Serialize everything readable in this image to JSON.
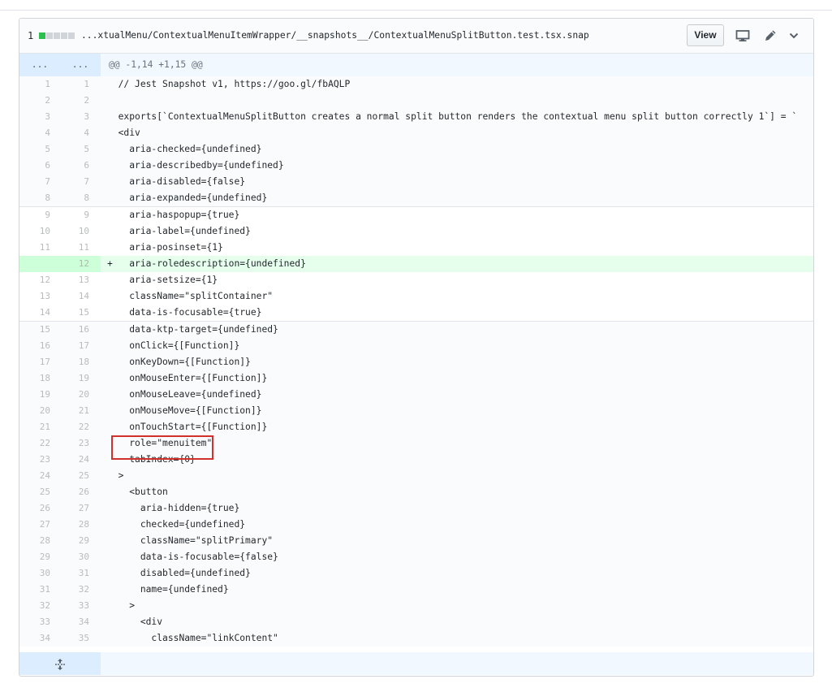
{
  "file": {
    "diffstat_count": "1",
    "path": "...xtualMenu/ContextualMenuItemWrapper/__snapshots__/ContextualMenuSplitButton.test.tsx.snap",
    "view_label": "View",
    "icons": [
      "desktop-icon",
      "pencil-icon",
      "chevron-down-icon"
    ]
  },
  "hunk": {
    "old_marker": "...",
    "new_marker": "...",
    "header": "@@ -1,14 +1,15 @@"
  },
  "lines": [
    {
      "old": "1",
      "new": "1",
      "sign": " ",
      "text": "// Jest Snapshot v1, https://goo.gl/fbAQLP"
    },
    {
      "old": "2",
      "new": "2",
      "sign": " ",
      "text": ""
    },
    {
      "old": "3",
      "new": "3",
      "sign": " ",
      "text": "exports[`ContextualMenuSplitButton creates a normal split button renders the contextual menu split button correctly 1`] = `"
    },
    {
      "old": "4",
      "new": "4",
      "sign": " ",
      "text": "<div"
    },
    {
      "old": "5",
      "new": "5",
      "sign": " ",
      "text": "  aria-checked={undefined}"
    },
    {
      "old": "6",
      "new": "6",
      "sign": " ",
      "text": "  aria-describedby={undefined}"
    },
    {
      "old": "7",
      "new": "7",
      "sign": " ",
      "text": "  aria-disabled={false}"
    },
    {
      "old": "8",
      "new": "8",
      "sign": " ",
      "text": "  aria-expanded={undefined}"
    },
    {
      "old": "9",
      "new": "9",
      "sign": " ",
      "text": "  aria-haspopup={true}"
    },
    {
      "old": "10",
      "new": "10",
      "sign": " ",
      "text": "  aria-label={undefined}"
    },
    {
      "old": "11",
      "new": "11",
      "sign": " ",
      "text": "  aria-posinset={1}"
    },
    {
      "old": "",
      "new": "12",
      "sign": "+",
      "text": "  aria-roledescription={undefined}"
    },
    {
      "old": "12",
      "new": "13",
      "sign": " ",
      "text": "  aria-setsize={1}"
    },
    {
      "old": "13",
      "new": "14",
      "sign": " ",
      "text": "  className=\"splitContainer\""
    },
    {
      "old": "14",
      "new": "15",
      "sign": " ",
      "text": "  data-is-focusable={true}"
    },
    {
      "old": "15",
      "new": "16",
      "sign": " ",
      "text": "  data-ktp-target={undefined}"
    },
    {
      "old": "16",
      "new": "17",
      "sign": " ",
      "text": "  onClick={[Function]}"
    },
    {
      "old": "17",
      "new": "18",
      "sign": " ",
      "text": "  onKeyDown={[Function]}"
    },
    {
      "old": "18",
      "new": "19",
      "sign": " ",
      "text": "  onMouseEnter={[Function]}"
    },
    {
      "old": "19",
      "new": "20",
      "sign": " ",
      "text": "  onMouseLeave={undefined}"
    },
    {
      "old": "20",
      "new": "21",
      "sign": " ",
      "text": "  onMouseMove={[Function]}"
    },
    {
      "old": "21",
      "new": "22",
      "sign": " ",
      "text": "  onTouchStart={[Function]}"
    },
    {
      "old": "22",
      "new": "23",
      "sign": " ",
      "text": "  role=\"menuitem\""
    },
    {
      "old": "23",
      "new": "24",
      "sign": " ",
      "text": "  tabIndex={0}"
    },
    {
      "old": "24",
      "new": "25",
      "sign": " ",
      "text": ">"
    },
    {
      "old": "25",
      "new": "26",
      "sign": " ",
      "text": "  <button"
    },
    {
      "old": "26",
      "new": "27",
      "sign": " ",
      "text": "    aria-hidden={true}"
    },
    {
      "old": "27",
      "new": "28",
      "sign": " ",
      "text": "    checked={undefined}"
    },
    {
      "old": "28",
      "new": "29",
      "sign": " ",
      "text": "    className=\"splitPrimary\""
    },
    {
      "old": "29",
      "new": "30",
      "sign": " ",
      "text": "    data-is-focusable={false}"
    },
    {
      "old": "30",
      "new": "31",
      "sign": " ",
      "text": "    disabled={undefined}"
    },
    {
      "old": "31",
      "new": "32",
      "sign": " ",
      "text": "    name={undefined}"
    },
    {
      "old": "32",
      "new": "33",
      "sign": " ",
      "text": "  >"
    },
    {
      "old": "33",
      "new": "34",
      "sign": " ",
      "text": "    <div"
    },
    {
      "old": "34",
      "new": "35",
      "sign": " ",
      "text": "      className=\"linkContent\""
    }
  ]
}
